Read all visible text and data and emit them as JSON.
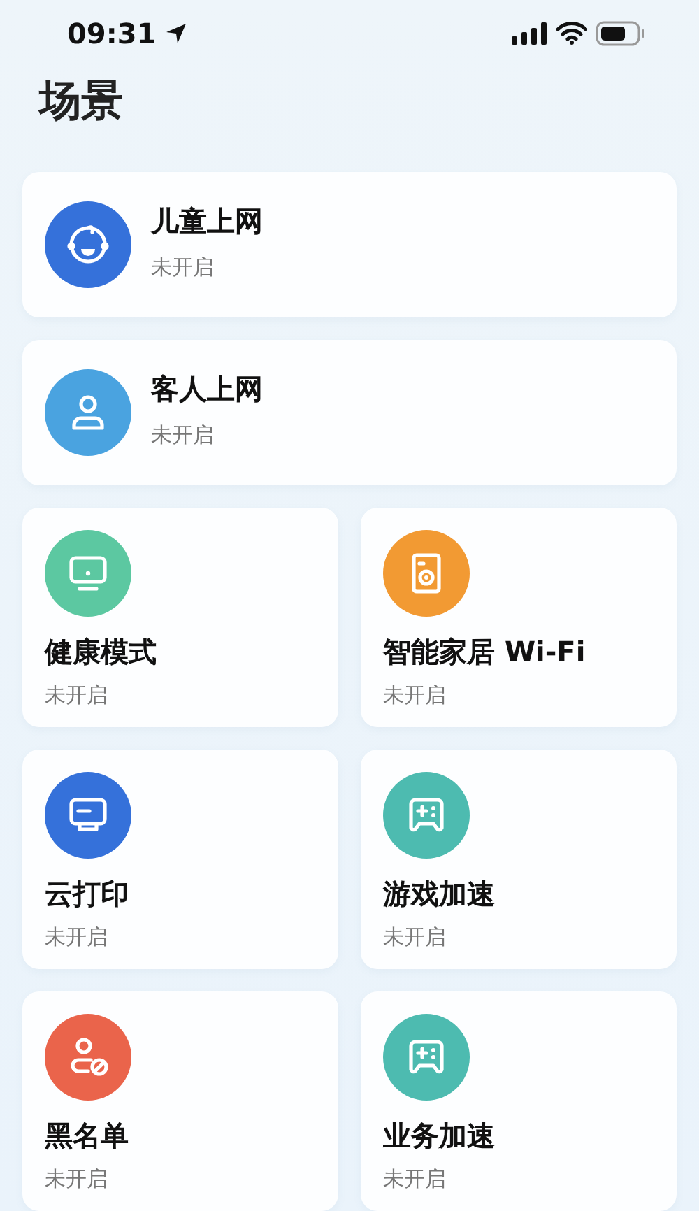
{
  "status_bar": {
    "time": "09:31"
  },
  "title": "场景",
  "wide_scenes": [
    {
      "kind": "child",
      "color": "#3571da",
      "name": "儿童上网",
      "status": "未开启"
    },
    {
      "kind": "guest",
      "color": "#4aa3e0",
      "name": "客人上网",
      "status": "未开启"
    }
  ],
  "grid_scenes": [
    {
      "kind": "monitor",
      "color": "#5cc8a1",
      "name": "健康模式",
      "status": "未开启"
    },
    {
      "kind": "washer",
      "color": "#f29a33",
      "name": "智能家居 Wi-Fi",
      "status": "未开启"
    },
    {
      "kind": "printer",
      "color": "#3571da",
      "name": "云打印",
      "status": "未开启"
    },
    {
      "kind": "gamepad",
      "color": "#4dbbb0",
      "name": "游戏加速",
      "status": "未开启"
    },
    {
      "kind": "blocklist",
      "color": "#ea644b",
      "name": "黑名单",
      "status": "未开启"
    },
    {
      "kind": "gamepad",
      "color": "#4dbbb0",
      "name": "业务加速",
      "status": "未开启"
    }
  ]
}
